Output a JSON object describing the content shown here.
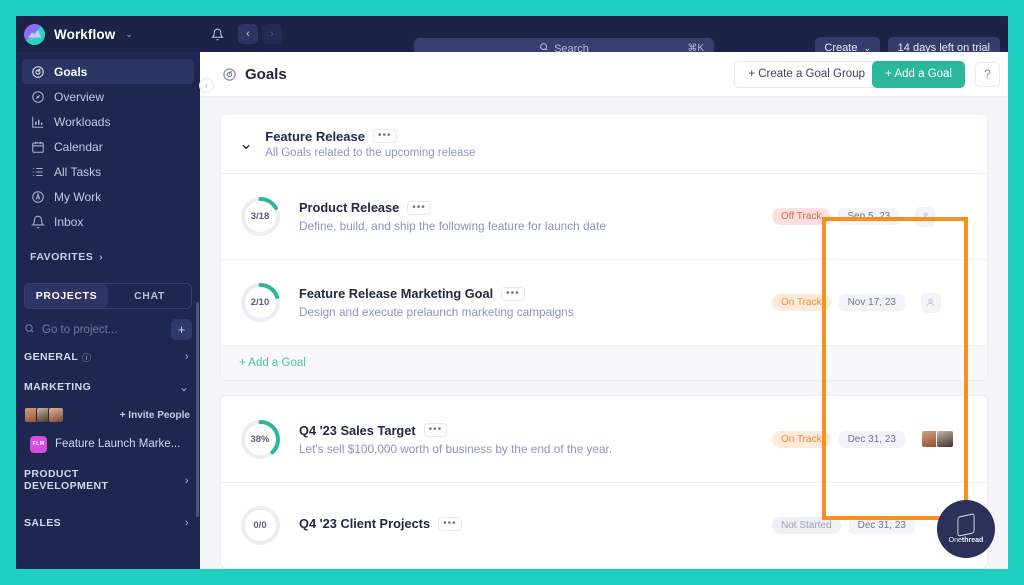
{
  "topbar": {
    "brand": "Workflow",
    "brand_caret": "⌄",
    "bell_icon": "bell-icon",
    "back_icon": "‹",
    "forward_icon": "›",
    "search_placeholder": "Search",
    "search_shortcut": "⌘K",
    "create_label": "Create",
    "create_caret": "⌄",
    "trial_label": "14 days left on trial"
  },
  "sidebar": {
    "nav": [
      {
        "label": "Goals",
        "icon": "goal-icon",
        "active": true
      },
      {
        "label": "Overview",
        "icon": "compass-icon",
        "active": false
      },
      {
        "label": "Workloads",
        "icon": "bar-chart-icon",
        "active": false
      },
      {
        "label": "Calendar",
        "icon": "calendar-icon",
        "active": false
      },
      {
        "label": "All Tasks",
        "icon": "list-icon",
        "active": false
      },
      {
        "label": "My Work",
        "icon": "target-icon",
        "active": false
      },
      {
        "label": "Inbox",
        "icon": "bell-icon",
        "active": false
      }
    ],
    "favorites_label": "FAVORITES",
    "favorites_chevron": "›",
    "tabs": [
      {
        "label": "PROJECTS",
        "active": true
      },
      {
        "label": "CHAT",
        "active": false
      }
    ],
    "search_placeholder": "Go to project...",
    "add_project_icon": "+",
    "sections": [
      {
        "label": "GENERAL",
        "has_info": true,
        "chevron": "›"
      },
      {
        "label": "MARKETING",
        "has_info": false,
        "chevron": "⌄"
      },
      {
        "label": "PRODUCT DEVELOPMENT",
        "has_info": false,
        "chevron": "›"
      },
      {
        "label": "SALES",
        "has_info": false,
        "chevron": "›"
      }
    ],
    "invite_label": "+ Invite People",
    "project": {
      "badge": "FLM",
      "name": "Feature Launch Marke..."
    }
  },
  "page": {
    "title": "Goals",
    "title_icon": "goal-icon",
    "create_group_label": "+ Create a Goal Group",
    "add_goal_label": "+ Add a Goal",
    "help_icon": "question-mark-icon",
    "collapse_icon": "‹"
  },
  "groups": [
    {
      "title": "Feature Release",
      "description": "All Goals related to the upcoming release",
      "menu_icon": "•••",
      "chevron": "⌄",
      "add_goal_label": "+ Add a Goal",
      "goals": [
        {
          "title": "Product Release",
          "description": "Define, build, and ship the following feature for launch date",
          "progress_label": "3/18",
          "progress_pct": 17,
          "status": "Off Track",
          "status_kind": "off",
          "due": "Sep 5, 23",
          "assignee_icon": "person-placeholder-icon",
          "menu_icon": "•••"
        },
        {
          "title": "Feature Release Marketing Goal",
          "description": "Design and execute prelaunch marketing campaigns",
          "progress_label": "2/10",
          "progress_pct": 20,
          "status": "On Track",
          "status_kind": "on",
          "due": "Nov 17, 23",
          "assignee_icon": "person-placeholder-icon",
          "menu_icon": "•••"
        }
      ]
    }
  ],
  "standalone_goals": [
    {
      "title": "Q4 '23 Sales Target",
      "description": "Let's sell $100,000 worth of business by the end of the year.",
      "progress_label": "38%",
      "progress_pct": 38,
      "status": "On Track",
      "status_kind": "on",
      "due": "Dec 31, 23",
      "avatars": 2,
      "menu_icon": "•••"
    },
    {
      "title": "Q4 '23 Client Projects",
      "description": "",
      "progress_label": "0/0",
      "progress_pct": 0,
      "status": "Not Started",
      "status_kind": "not",
      "due": "Dec 31, 23",
      "avatars": 0,
      "menu_icon": "•••"
    }
  ],
  "annotation": {
    "highlight_color": "#f7901e"
  },
  "widget": {
    "name_light": "One",
    "name_bold": "thread",
    "icon": "onethread-logo-icon"
  },
  "colors": {
    "accent_teal": "#1ecfc0",
    "primary_button": "#2bb79c",
    "sidebar_bg": "#1e2750",
    "topbar_bg": "#1b2347",
    "status_off": "#e4604e",
    "status_on": "#f08a34",
    "status_not": "#99a0bd",
    "highlight": "#f7901e"
  }
}
